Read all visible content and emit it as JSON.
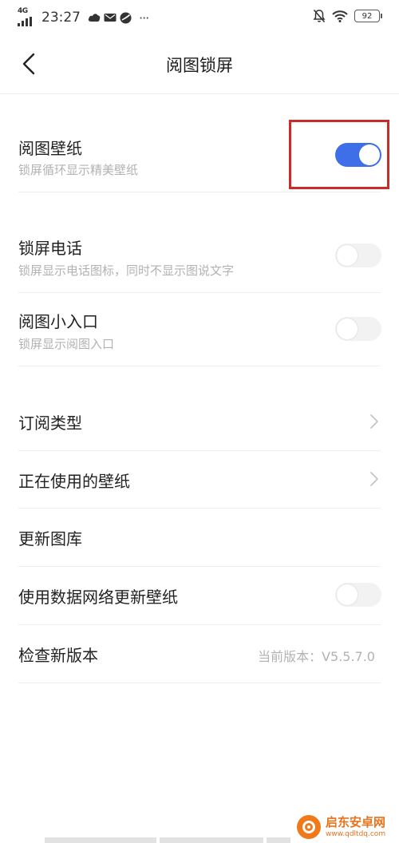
{
  "status_bar": {
    "network": "4G",
    "time": "23:27",
    "more": "···",
    "battery": "92"
  },
  "nav": {
    "title": "阅图锁屏"
  },
  "settings": {
    "wallpaper": {
      "title": "阅图壁纸",
      "subtitle": "锁屏循环显示精美壁纸",
      "enabled": true
    },
    "lock_phone": {
      "title": "锁屏电话",
      "subtitle": "锁屏显示电话图标，同时不显示图说文字",
      "enabled": false
    },
    "small_entry": {
      "title": "阅图小入口",
      "subtitle": "锁屏显示阅图入口",
      "enabled": false
    },
    "subscribe_type": {
      "title": "订阅类型"
    },
    "current_wallpaper": {
      "title": "正在使用的壁纸"
    },
    "update_gallery": {
      "title": "更新图库"
    },
    "mobile_data_update": {
      "title": "使用数据网络更新壁纸",
      "enabled": false
    },
    "check_version": {
      "title": "检查新版本",
      "value": "当前版本：V5.5.7.0"
    }
  },
  "watermark": {
    "name": "启东安卓网",
    "url": "www.qdltdq.com"
  },
  "colors": {
    "toggle_on": "#3e6fe9",
    "toggle_off": "#f2f2f2",
    "highlight": "#cc2b2b",
    "watermark": "#e8731c"
  }
}
